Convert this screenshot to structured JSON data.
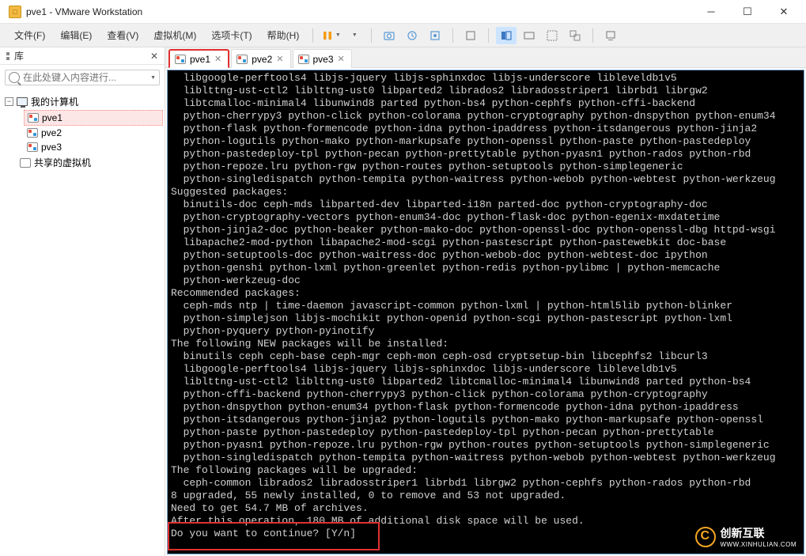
{
  "window": {
    "title": "pve1 - VMware Workstation"
  },
  "menu": {
    "file": "文件(F)",
    "edit": "编辑(E)",
    "view": "查看(V)",
    "vm": "虚拟机(M)",
    "tabs": "选项卡(T)",
    "help": "帮助(H)"
  },
  "sidebar": {
    "panel_title": "库",
    "search_placeholder": "在此处键入内容进行...",
    "nodes": {
      "root": "我的计算机",
      "pve1": "pve1",
      "pve2": "pve2",
      "pve3": "pve3",
      "shared": "共享的虚拟机"
    }
  },
  "tabs": {
    "t0": "pve1",
    "t1": "pve2",
    "t2": "pve3"
  },
  "console_text": "  libgoogle-perftools4 libjs-jquery libjs-sphinxdoc libjs-underscore libleveldb1v5\n  liblttng-ust-ctl2 liblttng-ust0 libparted2 librados2 libradosstriper1 librbd1 librgw2\n  libtcmalloc-minimal4 libunwind8 parted python-bs4 python-cephfs python-cffi-backend\n  python-cherrypy3 python-click python-colorama python-cryptography python-dnspython python-enum34\n  python-flask python-formencode python-idna python-ipaddress python-itsdangerous python-jinja2\n  python-logutils python-mako python-markupsafe python-openssl python-paste python-pastedeploy\n  python-pastedeploy-tpl python-pecan python-prettytable python-pyasn1 python-rados python-rbd\n  python-repoze.lru python-rgw python-routes python-setuptools python-simplegeneric\n  python-singledispatch python-tempita python-waitress python-webob python-webtest python-werkzeug\nSuggested packages:\n  binutils-doc ceph-mds libparted-dev libparted-i18n parted-doc python-cryptography-doc\n  python-cryptography-vectors python-enum34-doc python-flask-doc python-egenix-mxdatetime\n  python-jinja2-doc python-beaker python-mako-doc python-openssl-doc python-openssl-dbg httpd-wsgi\n  libapache2-mod-python libapache2-mod-scgi python-pastescript python-pastewebkit doc-base\n  python-setuptools-doc python-waitress-doc python-webob-doc python-webtest-doc ipython\n  python-genshi python-lxml python-greenlet python-redis python-pylibmc | python-memcache\n  python-werkzeug-doc\nRecommended packages:\n  ceph-mds ntp | time-daemon javascript-common python-lxml | python-html5lib python-blinker\n  python-simplejson libjs-mochikit python-openid python-scgi python-pastescript python-lxml\n  python-pyquery python-pyinotify\nThe following NEW packages will be installed:\n  binutils ceph ceph-base ceph-mgr ceph-mon ceph-osd cryptsetup-bin libcephfs2 libcurl3\n  libgoogle-perftools4 libjs-jquery libjs-sphinxdoc libjs-underscore libleveldb1v5\n  liblttng-ust-ctl2 liblttng-ust0 libparted2 libtcmalloc-minimal4 libunwind8 parted python-bs4\n  python-cffi-backend python-cherrypy3 python-click python-colorama python-cryptography\n  python-dnspython python-enum34 python-flask python-formencode python-idna python-ipaddress\n  python-itsdangerous python-jinja2 python-logutils python-mako python-markupsafe python-openssl\n  python-paste python-pastedeploy python-pastedeploy-tpl python-pecan python-prettytable\n  python-pyasn1 python-repoze.lru python-rgw python-routes python-setuptools python-simplegeneric\n  python-singledispatch python-tempita python-waitress python-webob python-webtest python-werkzeug\nThe following packages will be upgraded:\n  ceph-common librados2 libradosstriper1 librbd1 librgw2 python-cephfs python-rados python-rbd\n8 upgraded, 55 newly installed, 0 to remove and 53 not upgraded.\nNeed to get 54.7 MB of archives.\nAfter this operation, 180 MB of additional disk space will be used.\nDo you want to continue? [Y/n]",
  "watermark": {
    "text": "创新互联",
    "url": "WWW.XINHULIAN.COM"
  }
}
